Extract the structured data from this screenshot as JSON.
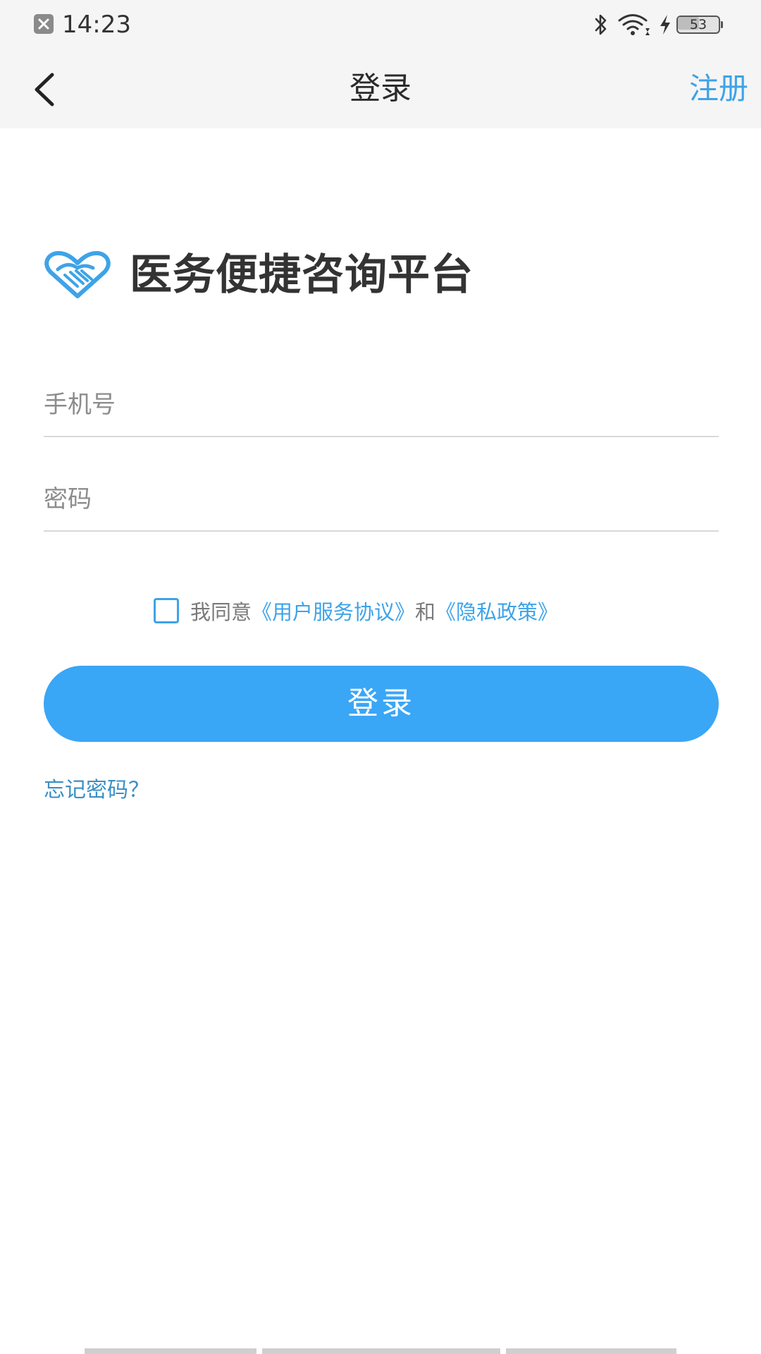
{
  "status_bar": {
    "time": "14:23",
    "battery": "53",
    "battery_fraction": 0.53,
    "icons": [
      "notification-close-icon",
      "bluetooth-icon",
      "wifi-icon",
      "charging-icon",
      "battery-icon"
    ]
  },
  "nav": {
    "back_icon": "chevron-left-icon",
    "title": "登录",
    "register_label": "注册"
  },
  "brand": {
    "logo_icon": "heart-handshake-icon",
    "name": "医务便捷咨询平台"
  },
  "form": {
    "phone_placeholder": "手机号",
    "phone_value": "",
    "password_placeholder": "密码",
    "password_value": ""
  },
  "agreement": {
    "checked": false,
    "prefix": "我同意",
    "link_terms": "《用户服务协议》",
    "conjunction": "和",
    "link_privacy": "《隐私政策》"
  },
  "login_button": "登录",
  "forgot_password": "忘记密码？",
  "colors": {
    "accent": "#3ea3e8",
    "button": "#3aa6f6",
    "bar_background": "#f5f5f5"
  }
}
